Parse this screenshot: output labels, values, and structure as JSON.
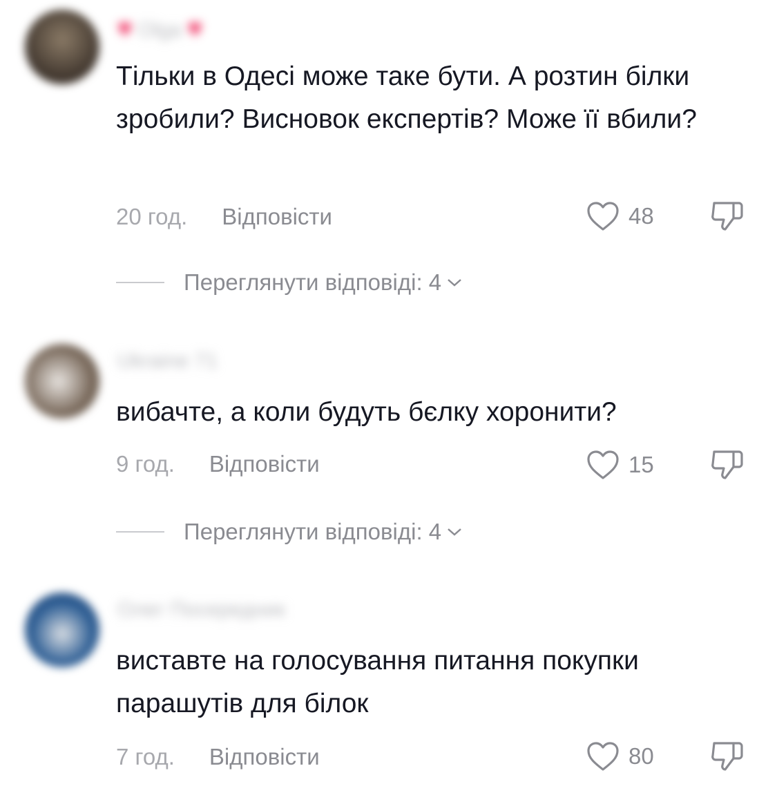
{
  "comments": [
    {
      "username": "Olga",
      "has_heart_badges": true,
      "text": "Тільки в Одесі може таке бути. А розтин білки зробили? Висновок експертів? Може її вбили?",
      "time": "20 год.",
      "reply_label": "Відповісти",
      "likes": "48",
      "view_replies": "Переглянути відповіді: 4"
    },
    {
      "username": "Ukraine 71",
      "has_heart_badges": false,
      "text": "вибачте, а коли будуть бєлку хоронити?",
      "time": "9 год.",
      "reply_label": "Відповісти",
      "likes": "15",
      "view_replies": "Переглянути відповіді: 4"
    },
    {
      "username": "Олег Посередник",
      "has_heart_badges": false,
      "text": "виставте на голосування питання покупки парашутів для білок",
      "time": "7 год.",
      "reply_label": "Відповісти",
      "likes": "80"
    }
  ],
  "icons": {
    "like": "heart-outline-icon",
    "dislike": "thumbs-down-icon",
    "expand": "chevron-down-icon"
  },
  "colors": {
    "text": "#161823",
    "secondary": "#8a8b91",
    "badge": "#ee1d52"
  }
}
